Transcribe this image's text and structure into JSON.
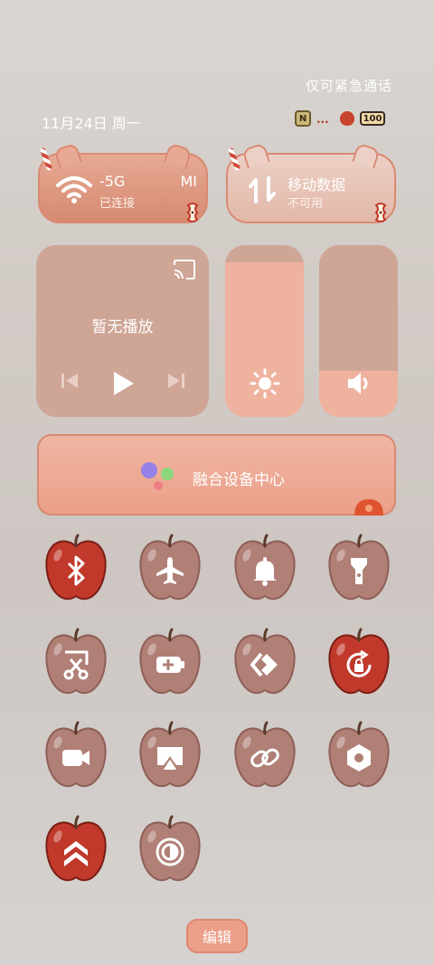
{
  "header": {
    "emergency_only": "仅可紧急通话",
    "date": "11月24日 周一"
  },
  "status_bar": {
    "nfc_label": "N",
    "signal_label": "...",
    "battery": "100"
  },
  "wifi": {
    "ssid_left": "-5G",
    "ssid_right": "MI",
    "status": "已连接",
    "icon": "wifi-icon"
  },
  "mobile": {
    "title": "移动数据",
    "status": "不可用",
    "icon": "mobile-data-icon"
  },
  "media": {
    "title": "暂无播放"
  },
  "brightness_level": 0.9,
  "volume_level": 0.27,
  "fusion": {
    "label": "融合设备中心"
  },
  "toggles": [
    {
      "name": "bluetooth",
      "icon": "bluetooth-icon",
      "active": true
    },
    {
      "name": "airplane-mode",
      "icon": "airplane-icon",
      "active": false
    },
    {
      "name": "ring-mode",
      "icon": "bell-icon",
      "active": false
    },
    {
      "name": "flashlight",
      "icon": "flashlight-icon",
      "active": false
    },
    {
      "name": "screenshot",
      "icon": "scissors-icon",
      "active": false
    },
    {
      "name": "battery-saver",
      "icon": "battery-plus-icon",
      "active": false
    },
    {
      "name": "nearby-share",
      "icon": "share-arrows-icon",
      "active": false
    },
    {
      "name": "rotation-lock",
      "icon": "rotation-lock-icon",
      "active": true
    },
    {
      "name": "screen-record",
      "icon": "video-camera-icon",
      "active": false
    },
    {
      "name": "screen-cast",
      "icon": "cast-screen-icon",
      "active": false
    },
    {
      "name": "link",
      "icon": "link-icon",
      "active": false
    },
    {
      "name": "settings",
      "icon": "hex-nut-icon",
      "active": false
    },
    {
      "name": "performance-mode",
      "icon": "chevrons-up-icon",
      "active": true
    },
    {
      "name": "dark-mode",
      "icon": "contrast-icon",
      "active": false
    }
  ],
  "colors": {
    "active_apple": "#c0392b",
    "inactive_apple": "#b07f76",
    "accent": "#ec9f88"
  },
  "edit": {
    "label": "编辑"
  }
}
